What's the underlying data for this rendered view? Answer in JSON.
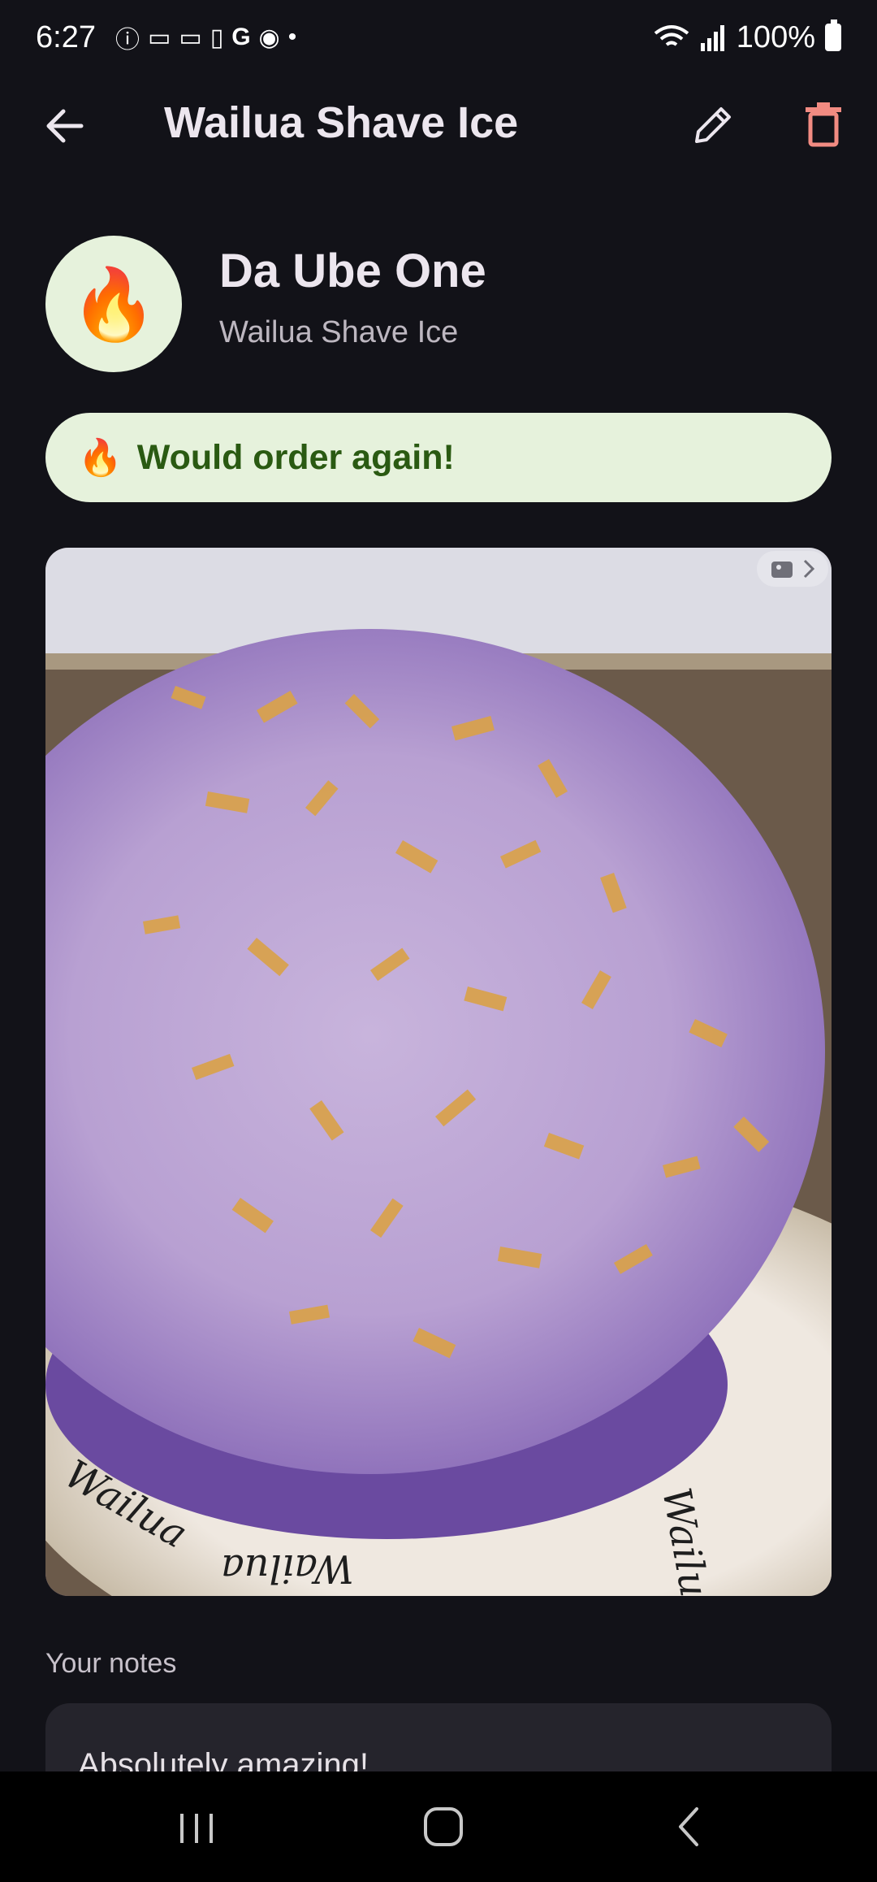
{
  "status_bar": {
    "time": "6:27",
    "battery": "100%",
    "left_icons": [
      "info-icon",
      "voicemail-icon",
      "voicemail-icon",
      "phone-icon",
      "google-icon",
      "messages-icon",
      "dot-icon"
    ],
    "right_icons": [
      "wifi-icon",
      "signal-icon",
      "battery-icon"
    ]
  },
  "app_bar": {
    "title": "Wailua Shave Ice",
    "back_icon": "arrow-left-icon",
    "edit_icon": "pencil-icon",
    "delete_icon": "trash-icon",
    "delete_color": "#f28b82"
  },
  "item": {
    "emoji": "🔥",
    "name": "Da Ube One",
    "place": "Wailua Shave Ice"
  },
  "verdict": {
    "emoji": "🔥",
    "text": "Would order again!",
    "bg_color": "#e6f2dc",
    "text_color": "#2a5a12"
  },
  "photo": {
    "description_icon": "photo-icon"
  },
  "notes": {
    "label": "Your notes",
    "text": "Absolutely amazing!"
  },
  "nav_bar": {
    "icons": [
      "recents-icon",
      "home-icon",
      "back-icon"
    ]
  }
}
